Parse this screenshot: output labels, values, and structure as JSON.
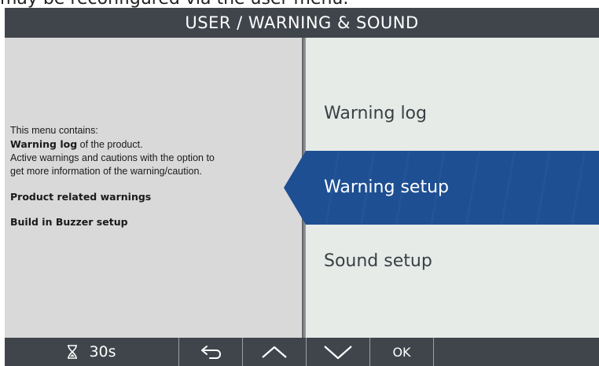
{
  "caption": "may be reconfigured via the user menu.",
  "header": {
    "title": "USER / WARNING & SOUND"
  },
  "description": {
    "intro": "This menu contains:",
    "warning_log_bold": "Warning log",
    "warning_log_rest": " of the product.",
    "active_line1": "Active warnings and cautions with the option to",
    "active_line2": "get more information of the warning/caution.",
    "product_warnings": "Product related warnings",
    "buzzer_setup": "Build in Buzzer setup"
  },
  "menu": {
    "items": [
      {
        "label": "Warning log",
        "selected": false
      },
      {
        "label": "Warning setup",
        "selected": true
      },
      {
        "label": "Sound setup",
        "selected": false
      }
    ]
  },
  "footer": {
    "timer_icon": "hourglass-icon",
    "timer_label": "30s",
    "back_icon": "back-arrow-icon",
    "up_icon": "chevron-up-icon",
    "down_icon": "chevron-down-icon",
    "ok_label": "OK"
  },
  "colors": {
    "bar": "#3f454b",
    "left_panel": "#d9d9d9",
    "right_panel": "#e6ebe8",
    "selected": "#1e4f93"
  }
}
